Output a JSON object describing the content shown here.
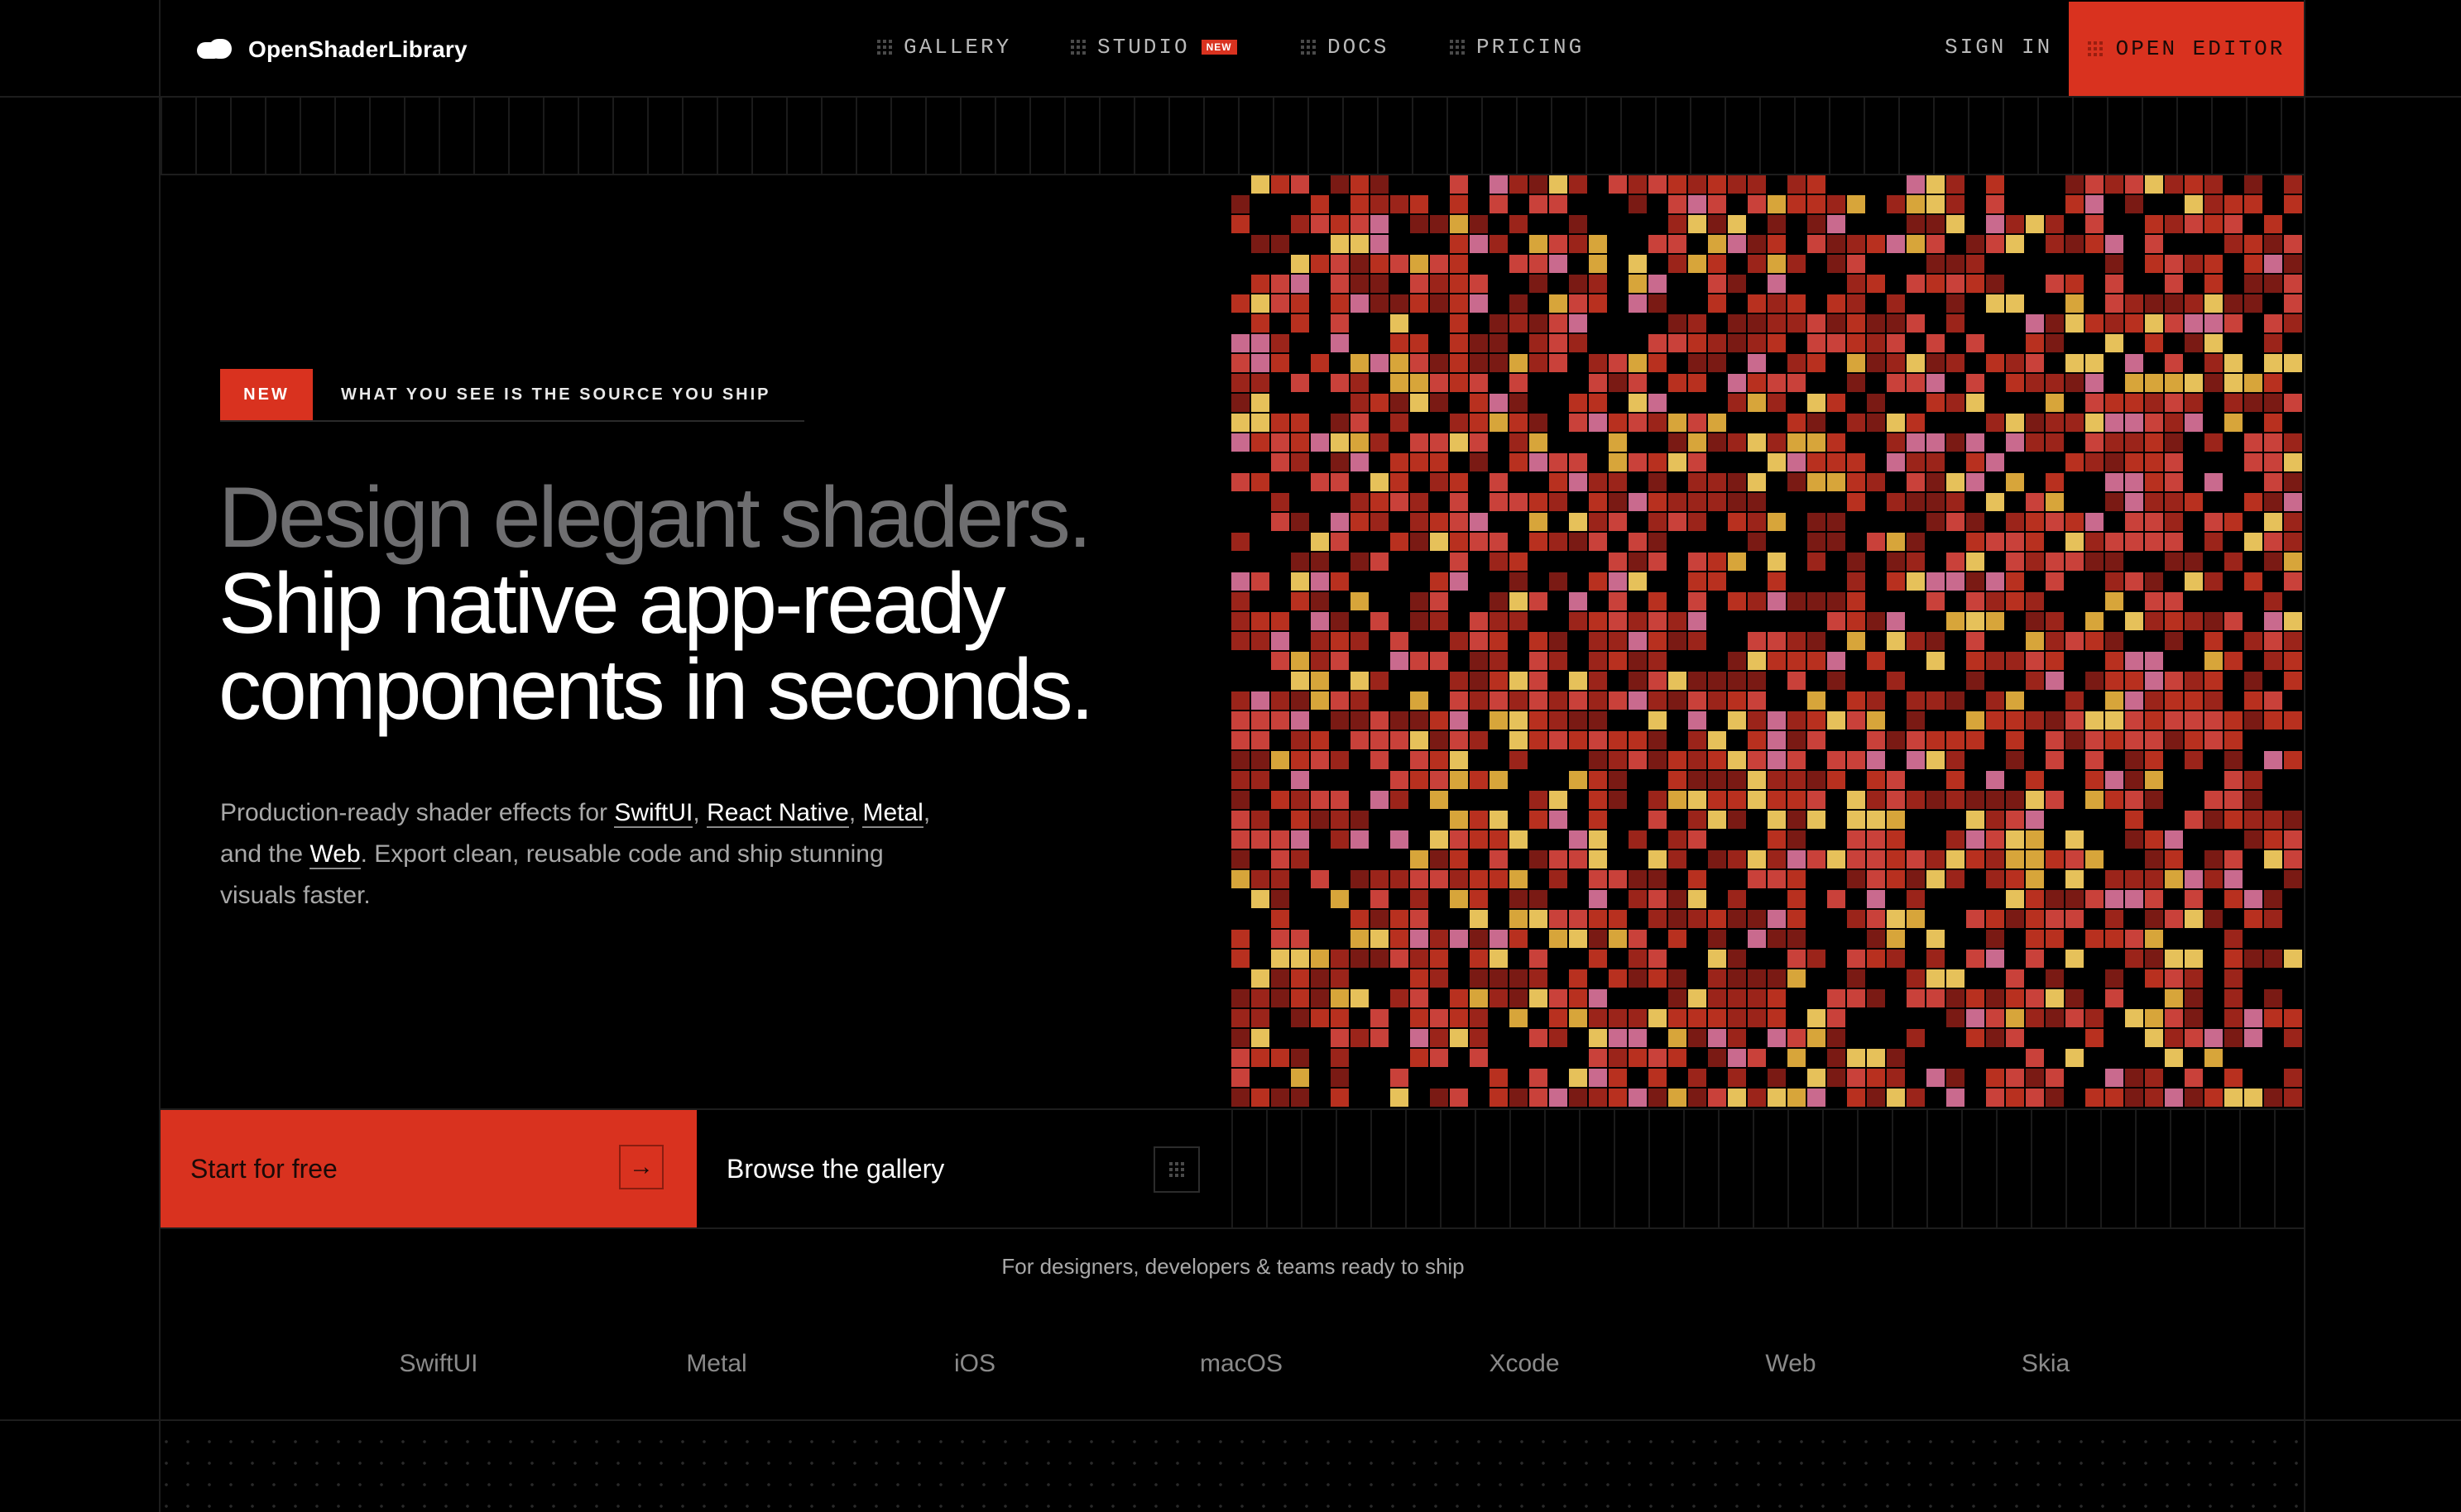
{
  "brand": {
    "name": "OpenShaderLibrary"
  },
  "nav": {
    "items": [
      {
        "label": "GALLERY"
      },
      {
        "label": "STUDIO",
        "badge": "NEW"
      },
      {
        "label": "DOCS"
      },
      {
        "label": "PRICING"
      }
    ],
    "sign_in": "SIGN IN",
    "open_editor": "OPEN EDITOR"
  },
  "hero": {
    "tag_badge": "NEW",
    "tag_text": "WHAT YOU SEE IS THE SOURCE YOU SHIP",
    "headline_line1": "Design elegant shaders.",
    "headline_line2": "Ship native app-ready",
    "headline_line3": "components in seconds.",
    "desc_prefix": "Production-ready shader effects for ",
    "link_swiftui": "SwiftUI",
    "sep1": ", ",
    "link_react_native": "React Native",
    "sep2": ", ",
    "link_metal": "Metal",
    "desc_mid": ", and the ",
    "link_web": "Web",
    "desc_suffix": ". Export clean, reusable code and ship stunning visuals faster."
  },
  "cta": {
    "start_label": "Start for free",
    "start_icon": "arrow-right-icon",
    "browse_label": "Browse the gallery",
    "browse_icon": "grid-icon"
  },
  "audience": {
    "text": "For designers, developers & teams ready to ship",
    "platforms": [
      "SwiftUI",
      "Metal",
      "iOS",
      "macOS",
      "Xcode",
      "Web",
      "Skia"
    ]
  },
  "colors": {
    "accent": "#d9321f",
    "shader_palette": [
      "#7a1a14",
      "#9b241a",
      "#b8301f",
      "#c9413a",
      "#d98060",
      "#c96a8e",
      "#d7a53a",
      "#e6c15a"
    ]
  }
}
